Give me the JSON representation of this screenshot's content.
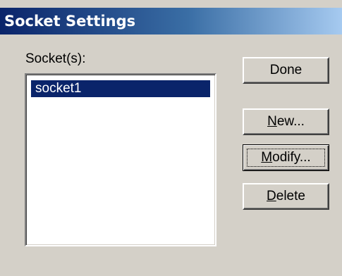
{
  "window": {
    "title": "Socket Settings"
  },
  "sockets": {
    "label": "Socket(s):",
    "items": [
      {
        "label": "socket1",
        "selected": true
      }
    ]
  },
  "buttons": {
    "done": {
      "label": "Done"
    },
    "new": {
      "mnemonic": "N",
      "rest": "ew..."
    },
    "modify": {
      "mnemonic": "M",
      "rest": "odify..."
    },
    "delete": {
      "mnemonic": "D",
      "rest": "elete"
    }
  },
  "colors": {
    "face": "#d4d0c8",
    "title_start": "#0a246a",
    "title_end": "#a6caf0",
    "selection": "#0a246a"
  }
}
